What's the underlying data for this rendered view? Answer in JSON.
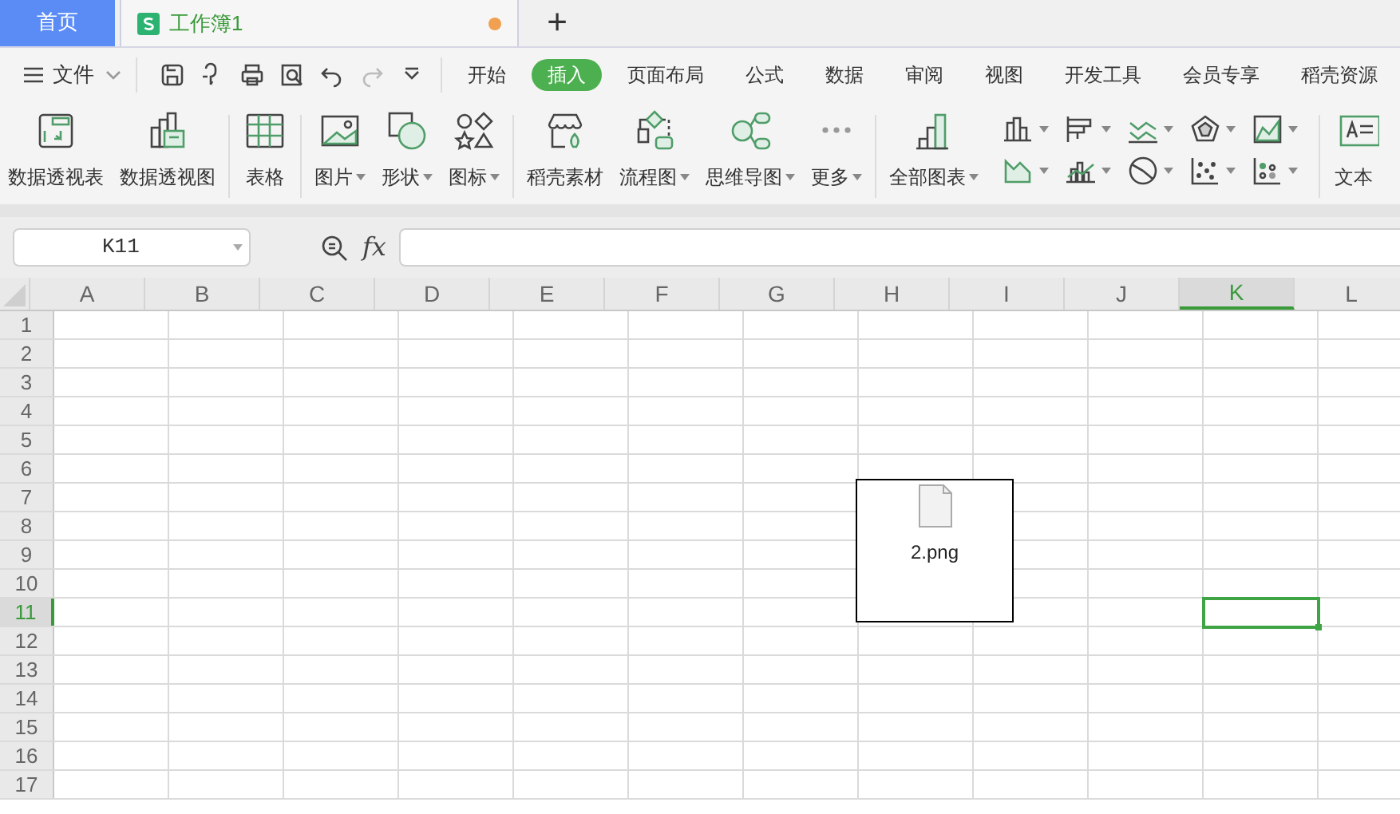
{
  "tabs": [
    {
      "label": "首页",
      "kind": "home",
      "selected": false
    },
    {
      "label": "工作簿1",
      "kind": "document",
      "selected": true,
      "unsaved": true
    }
  ],
  "new_tab": "+",
  "file_menu": "文件",
  "ribbon_tabs": [
    {
      "label": "开始",
      "selected": false
    },
    {
      "label": "插入",
      "selected": true
    },
    {
      "label": "页面布局",
      "selected": false
    },
    {
      "label": "公式",
      "selected": false
    },
    {
      "label": "数据",
      "selected": false
    },
    {
      "label": "审阅",
      "selected": false
    },
    {
      "label": "视图",
      "selected": false
    },
    {
      "label": "开发工具",
      "selected": false
    },
    {
      "label": "会员专享",
      "selected": false
    },
    {
      "label": "稻壳资源",
      "selected": false
    }
  ],
  "ribbon_groups": [
    [
      {
        "label": "数据透视表",
        "dropdown": false
      },
      {
        "label": "数据透视图",
        "dropdown": false
      }
    ],
    [
      {
        "label": "表格",
        "dropdown": false
      }
    ],
    [
      {
        "label": "图片",
        "dropdown": true
      },
      {
        "label": "形状",
        "dropdown": true
      },
      {
        "label": "图标",
        "dropdown": true
      }
    ],
    [
      {
        "label": "稻壳素材",
        "dropdown": false
      },
      {
        "label": "流程图",
        "dropdown": true
      },
      {
        "label": "思维导图",
        "dropdown": true
      },
      {
        "label": "更多",
        "dropdown": true
      }
    ],
    [
      {
        "label": "全部图表",
        "dropdown": true
      }
    ]
  ],
  "ribbon_cut_label": "文本",
  "name_box": "K11",
  "formula_label": "fx",
  "sheet": {
    "columns": [
      {
        "label": "A",
        "selected": false
      },
      {
        "label": "B",
        "selected": false
      },
      {
        "label": "C",
        "selected": false
      },
      {
        "label": "D",
        "selected": false
      },
      {
        "label": "E",
        "selected": false
      },
      {
        "label": "F",
        "selected": false
      },
      {
        "label": "G",
        "selected": false
      },
      {
        "label": "H",
        "selected": false
      },
      {
        "label": "I",
        "selected": false
      },
      {
        "label": "J",
        "selected": false
      },
      {
        "label": "K",
        "selected": true
      },
      {
        "label": "L",
        "selected": false
      }
    ],
    "rows": [
      {
        "label": "1",
        "selected": false
      },
      {
        "label": "2",
        "selected": false
      },
      {
        "label": "3",
        "selected": false
      },
      {
        "label": "4",
        "selected": false
      },
      {
        "label": "5",
        "selected": false
      },
      {
        "label": "6",
        "selected": false
      },
      {
        "label": "7",
        "selected": false
      },
      {
        "label": "8",
        "selected": false
      },
      {
        "label": "9",
        "selected": false
      },
      {
        "label": "10",
        "selected": false
      },
      {
        "label": "11",
        "selected": true
      },
      {
        "label": "12",
        "selected": false
      },
      {
        "label": "13",
        "selected": false
      },
      {
        "label": "14",
        "selected": false
      },
      {
        "label": "15",
        "selected": false
      },
      {
        "label": "16",
        "selected": false
      },
      {
        "label": "17",
        "selected": false
      }
    ],
    "embedded_file": {
      "label": "2.png"
    }
  }
}
